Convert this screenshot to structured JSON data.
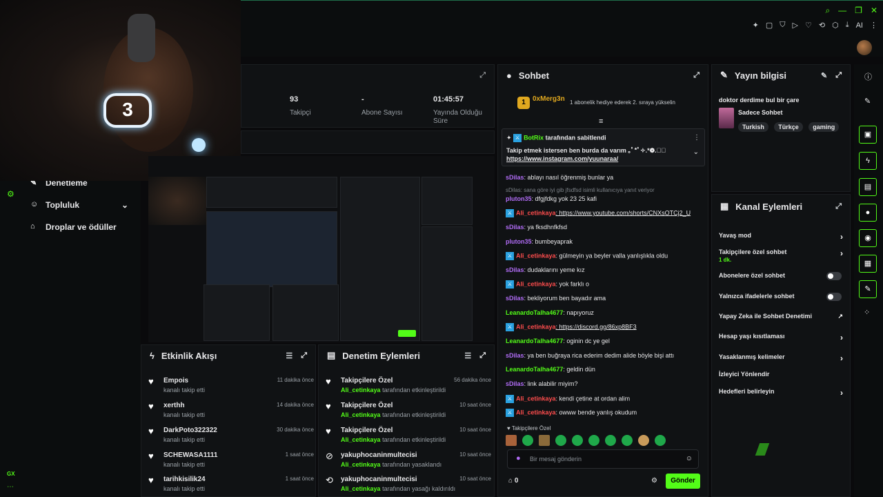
{
  "stats": {
    "followers_value": "93",
    "followers_label": "Takipçi",
    "subs_value": "-",
    "subs_label": "Abone Sayısı",
    "uptime_value": "01:45:57",
    "uptime_label": "Yayında Olduğu Süre"
  },
  "sidebar": {
    "items": [
      {
        "label": "Denetleme"
      },
      {
        "label": "Topluluk"
      },
      {
        "label": "Droplar ve ödüller"
      }
    ],
    "footer": "GX"
  },
  "events": {
    "title": "Etkinlik Akışı",
    "items": [
      {
        "name": "Empois",
        "sub": "kanalı takip etti",
        "time": "11 dakika önce"
      },
      {
        "name": "xerthh",
        "sub": "kanalı takip etti",
        "time": "14 dakika önce"
      },
      {
        "name": "DarkPoto322322",
        "sub": "kanalı takip etti",
        "time": "30 dakika önce"
      },
      {
        "name": "SCHEWASA1111",
        "sub": "kanalı takip etti",
        "time": "1 saat önce"
      },
      {
        "name": "tarihkisilik24",
        "sub": "kanalı takip etti",
        "time": "1 saat önce"
      }
    ]
  },
  "moderation": {
    "title": "Denetim Eylemleri",
    "items": [
      {
        "name": "Takipçilere Özel",
        "user": "Ali_cetinkaya",
        "sub": "tarafından etkinleştirildi",
        "time": "56 dakika önce"
      },
      {
        "name": "Takipçilere Özel",
        "user": "Ali_cetinkaya",
        "sub": "tarafından etkinleştirildi",
        "time": "10 saat önce"
      },
      {
        "name": "Takipçilere Özel",
        "user": "Ali_cetinkaya",
        "sub": "tarafından etkinleştirildi",
        "time": "10 saat önce"
      },
      {
        "name": "yakuphocaninmultecisi",
        "user": "Ali_cetinkaya",
        "sub": "tarafından yasaklandı",
        "time": "10 saat önce"
      },
      {
        "name": "yakuphocaninmultecisi",
        "user": "Ali_cetinkaya",
        "sub": "tarafından yasağı kaldırıldı",
        "time": "10 saat önce"
      }
    ]
  },
  "chat": {
    "title": "Sohbet",
    "top_user": "0xMerg3n",
    "top_rank": "1",
    "top_note": "1 abonelik hediye ederek 2. sıraya yükselin",
    "pinned_by": "BotRix",
    "pinned_label": "tarafından sabitlendi",
    "pinned_text": "Takip etmek istersen ben burda da varım ｡ﾟ*ﾟ✧.*❁.✧ﾟ",
    "pinned_link": "https://www.instagram.com/yuunaraa/",
    "messages": [
      {
        "user": "sDilas",
        "text": ": ablayı nasıl öğrenmiş bunlar ya"
      },
      {
        "user": "",
        "text": "sDilas: sana göre iyi gib jfsdfsd isimli kullanıcıya yanıt veriyor"
      },
      {
        "user": "pluton35",
        "text": ": dfgjfdkg yok 23 25 kafi"
      },
      {
        "user": "Ali_cetinkaya",
        "text": ": https://www.youtube.com/shorts/CNXsOTCj2_U"
      },
      {
        "user": "sDilas",
        "text": ": ya fksdhnfkfsd"
      },
      {
        "user": "pluton35",
        "text": ": bumbeyaprak"
      },
      {
        "user": "Ali_cetinkaya",
        "text": ": gülmeyin ya beyler valla yanlışlıkla oldu"
      },
      {
        "user": "sDilas",
        "text": ": dudaklarını yeme kız"
      },
      {
        "user": "Ali_cetinkaya",
        "text": ": yok farklı o"
      },
      {
        "user": "sDilas",
        "text": ": bekliyorum ben bayadır ama"
      },
      {
        "user": "LeanardoTalha4677",
        "text": ": napıyoruz"
      },
      {
        "user": "Ali_cetinkaya",
        "text": ": https://discord.gg/86xp8BF3"
      },
      {
        "user": "LeanardoTalha4677",
        "text": ": oginin dc ye gel"
      },
      {
        "user": "sDilas",
        "text": ": ya ben buğraya rica ederim dedim alide böyle bişi attı"
      },
      {
        "user": "LeanardoTalha4677",
        "text": ": geldin dün"
      },
      {
        "user": "sDilas",
        "text": ": link alabilir miyim?"
      },
      {
        "user": "Ali_cetinkaya",
        "text": ": kendi çetine at ordan alim"
      },
      {
        "user": "Ali_cetinkaya",
        "text": ": owww bende yanlış okudum"
      }
    ],
    "mode": "Takipçilere Özel",
    "placeholder": "Bir mesaj gönderin",
    "points": "0",
    "send": "Gönder"
  },
  "info": {
    "title": "Yayın bilgisi",
    "stream_title": "doktor derdime bul bir çare",
    "category": "Sadece Sohbet",
    "tags": [
      "Turkish",
      "Türkçe",
      "gaming"
    ]
  },
  "channel_actions": {
    "title": "Kanal Eylemleri",
    "items": [
      {
        "label": "Yavaş mod",
        "control": "chevron"
      },
      {
        "label": "Takipçilere özel sohbet",
        "sub": "1 dk.",
        "control": "chevron"
      },
      {
        "label": "Abonelere özel sohbet",
        "control": "toggle"
      },
      {
        "label": "Yalnızca ifadelerle sohbet",
        "control": "toggle"
      },
      {
        "label": "Yapay Zeka ile Sohbet Denetimi",
        "control": "external"
      },
      {
        "label": "Hesap yaşı kısıtlaması",
        "control": "chevron"
      },
      {
        "label": "Yasaklanmış kelimeler",
        "control": "chevron"
      },
      {
        "label": "İzleyici Yönlendir",
        "control": "none"
      },
      {
        "label": "Hedefleri belirleyin",
        "control": "chevron"
      }
    ]
  },
  "colors": {
    "accent": "#53fc18",
    "background": "#0a0a0c",
    "panel": "#101214"
  }
}
